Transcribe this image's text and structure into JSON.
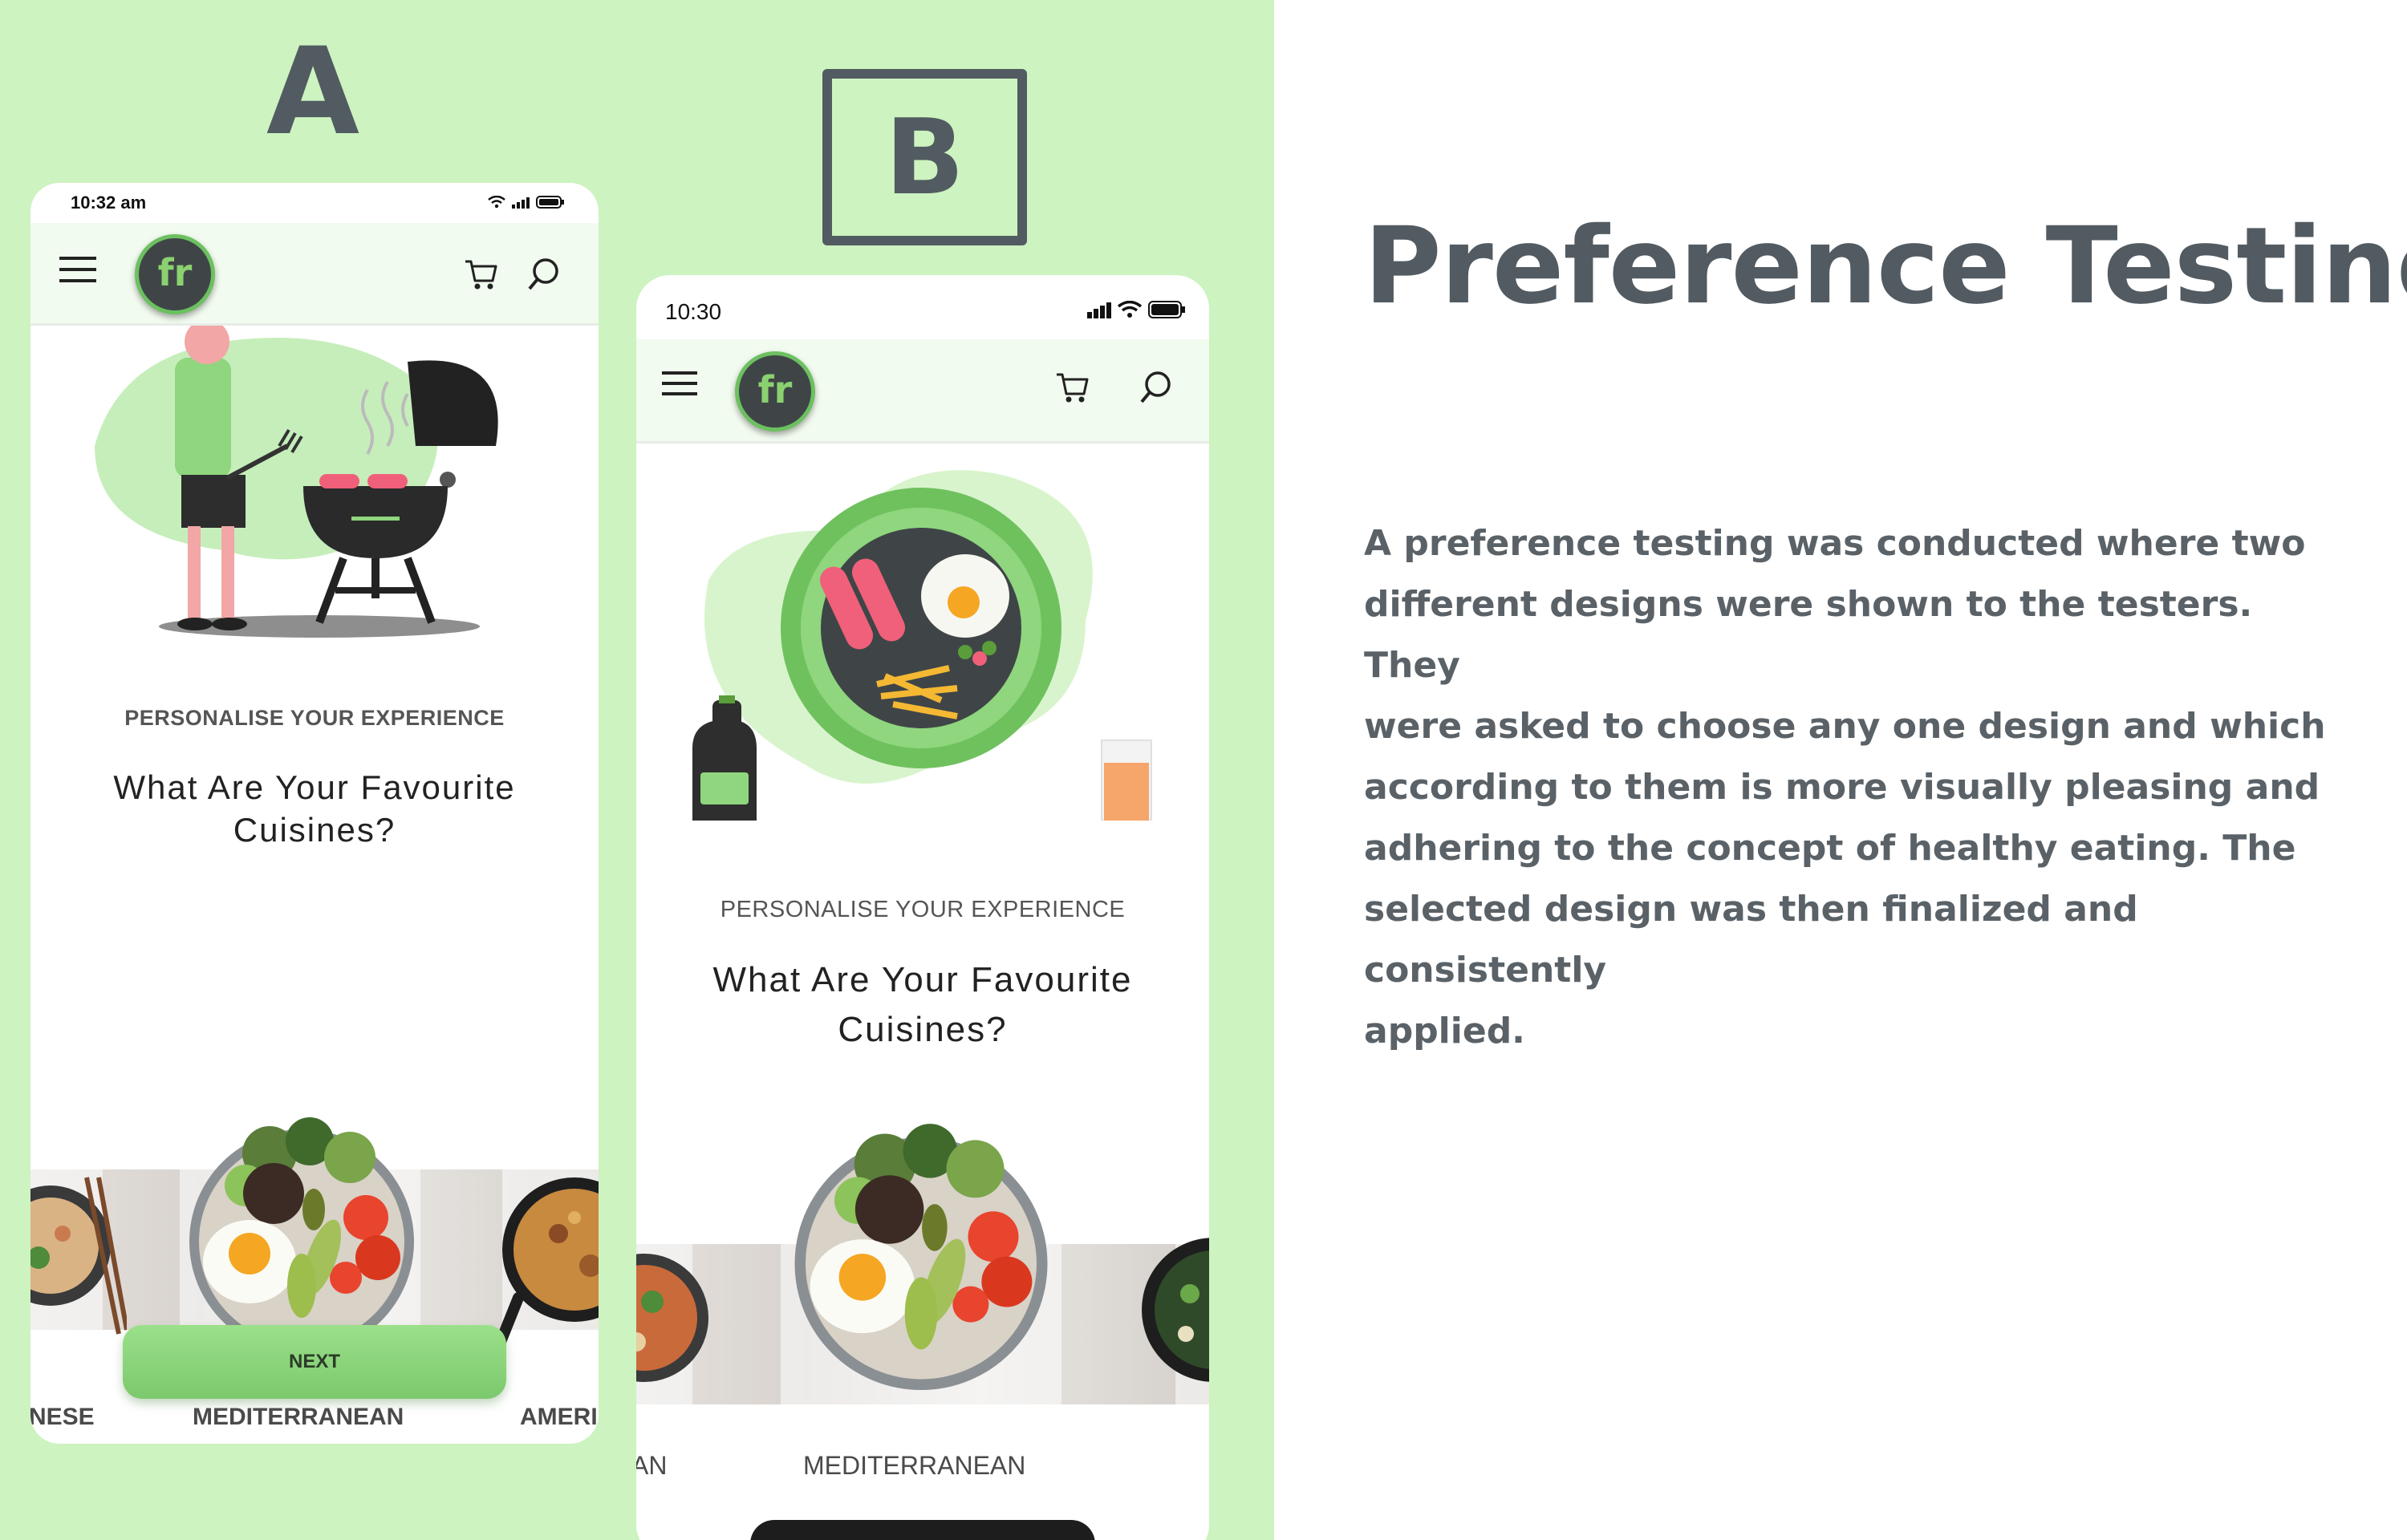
{
  "labels": {
    "a": "A",
    "b": "B"
  },
  "phone_a": {
    "status_time": "10:32 am",
    "eyebrow": "PERSONALISE YOUR EXPERIENCE",
    "question_line1": "What Are Your Favourite",
    "question_line2": "Cuisines?",
    "cuisines": [
      "NESE",
      "MEDITERRANEAN",
      "AMERI"
    ],
    "next_label": "NEXT"
  },
  "phone_b": {
    "status_time": "10:30",
    "eyebrow": "PERSONALISE YOUR EXPERIENCE",
    "question_line1": "What Are Your Favourite",
    "question_line2": "Cuisines?",
    "cuisines": [
      "AN",
      "MEDITERRANEAN"
    ]
  },
  "logo_text": "fr",
  "content": {
    "title": "Preference Testing",
    "lines": [
      "A preference testing was conducted where two",
      "different designs were shown to the testers. They",
      "were asked to choose any one design and which",
      "according to them is more visually pleasing and",
      "adhering to the concept of healthy eating. The",
      "selected design was then finalized and consistently",
      "applied."
    ]
  },
  "colors": {
    "panel_green": "#cdf3c0",
    "text_slate": "#525b61",
    "button_green": "#8fd67e"
  }
}
